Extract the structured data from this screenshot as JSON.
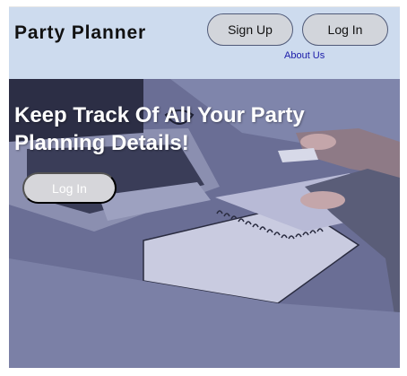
{
  "header": {
    "brand": "Party Planner",
    "signup_label": "Sign Up",
    "login_label": "Log In",
    "about_label": "About Us"
  },
  "hero": {
    "title": "Keep Track Of All Your Party Planning Details!",
    "login_label": "Log In",
    "image_subject": "laptop-and-notebook-on-desk-photo"
  },
  "colors": {
    "header_bg": "#cddbee",
    "hero_overlay": "#6b6f96",
    "link": "#1a1aa8",
    "button_bg": "#d2d5db"
  }
}
